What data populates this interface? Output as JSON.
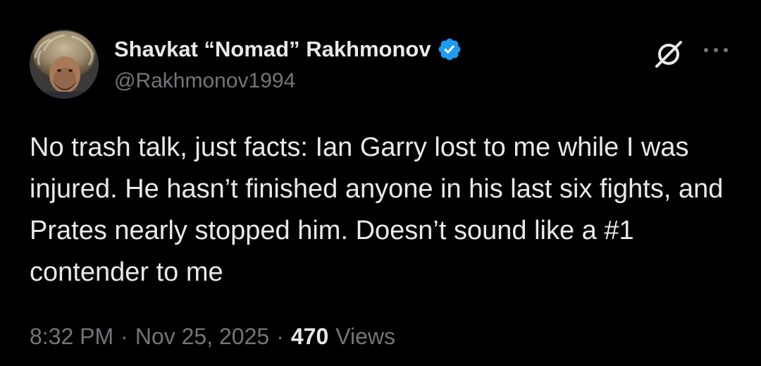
{
  "author": {
    "display_name": "Shavkat “Nomad” Rakhmonov",
    "handle": "@Rakhmonov1994",
    "verified_icon": "verified-badge-icon",
    "verified_color": "#1d9bf0"
  },
  "tweet": {
    "text": "No trash talk, just facts: Ian Garry lost to me while I was injured. He hasn’t finished anyone in his last six fights, and Prates nearly stopped him. Doesn’t sound like a #1 contender to me"
  },
  "meta": {
    "time": "8:32 PM",
    "separator": "·",
    "date": "Nov 25, 2025",
    "views_count": "470",
    "views_label": "Views"
  },
  "actions": {
    "grok_icon": "grok-icon",
    "more_icon": "more-horizontal-icon"
  },
  "colors": {
    "background": "#000000",
    "primary_text": "#e7e9ea",
    "secondary_text": "#71767b",
    "accent": "#1d9bf0"
  }
}
